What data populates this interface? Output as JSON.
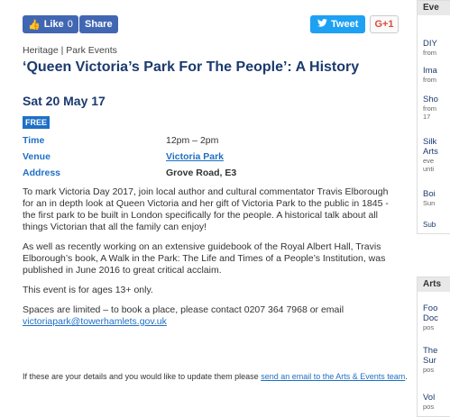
{
  "social": {
    "like_label": "Like",
    "like_count": "0",
    "share_label": "Share",
    "tweet_label": "Tweet",
    "gplus_label": "G+1"
  },
  "breadcrumb": "Heritage | Park Events",
  "title": "‘Queen Victoria’s Park For The People’: A History",
  "date": "Sat 20 May 17",
  "badge": "FREE",
  "details": [
    {
      "label": "Time",
      "value": "12pm – 2pm"
    },
    {
      "label": "Venue",
      "value": "Victoria Park"
    },
    {
      "label": "Address",
      "value": "Grove Road, E3"
    }
  ],
  "body": {
    "p1": "To mark Victoria Day 2017, join local author and cultural commentator Travis Elborough for an in depth look at Queen Victoria and her gift of Victoria Park to the public in 1845 - the first park to be built in London specifically for the people. A historical talk about all things Victorian that all the family can enjoy!",
    "p2": "As well as recently working on an extensive guidebook of the Royal Albert Hall, Travis Elborough’s book, A Walk in the Park: The Life and Times of a People’s Institution, was published in June 2016 to great critical acclaim.",
    "p3": "This event is for ages 13+ only.",
    "p4_text": "Spaces are limited – to book a place, please contact 0207 364 7968 or email",
    "p4_email": "victoriapark@towerhamlets.gov.uk"
  },
  "footer": {
    "text": "If these are your details and you would like to update them please",
    "link": "send an email to the Arts & Events team",
    "end": "."
  },
  "sidebar": {
    "panel1": {
      "heading": "Eve",
      "items": [
        {
          "title": "DIY",
          "sub": "from"
        },
        {
          "title": "Ima",
          "sub": "from"
        },
        {
          "title": "Sho",
          "sub": "from",
          "sub2": "17"
        },
        {
          "title": "Silk",
          "title2": "Arts",
          "sub": "eve",
          "sub2": "unti"
        },
        {
          "title": "Boi",
          "sub": "Sun"
        },
        {
          "title": "Sub"
        }
      ]
    },
    "panel2": {
      "heading": "Arts",
      "items": [
        {
          "title": "Foo",
          "title2": "Doc",
          "sub": "pos"
        },
        {
          "title": "The",
          "title2": "Sur",
          "sub": "pos"
        },
        {
          "title": "Vol",
          "sub": "pos"
        }
      ]
    }
  }
}
